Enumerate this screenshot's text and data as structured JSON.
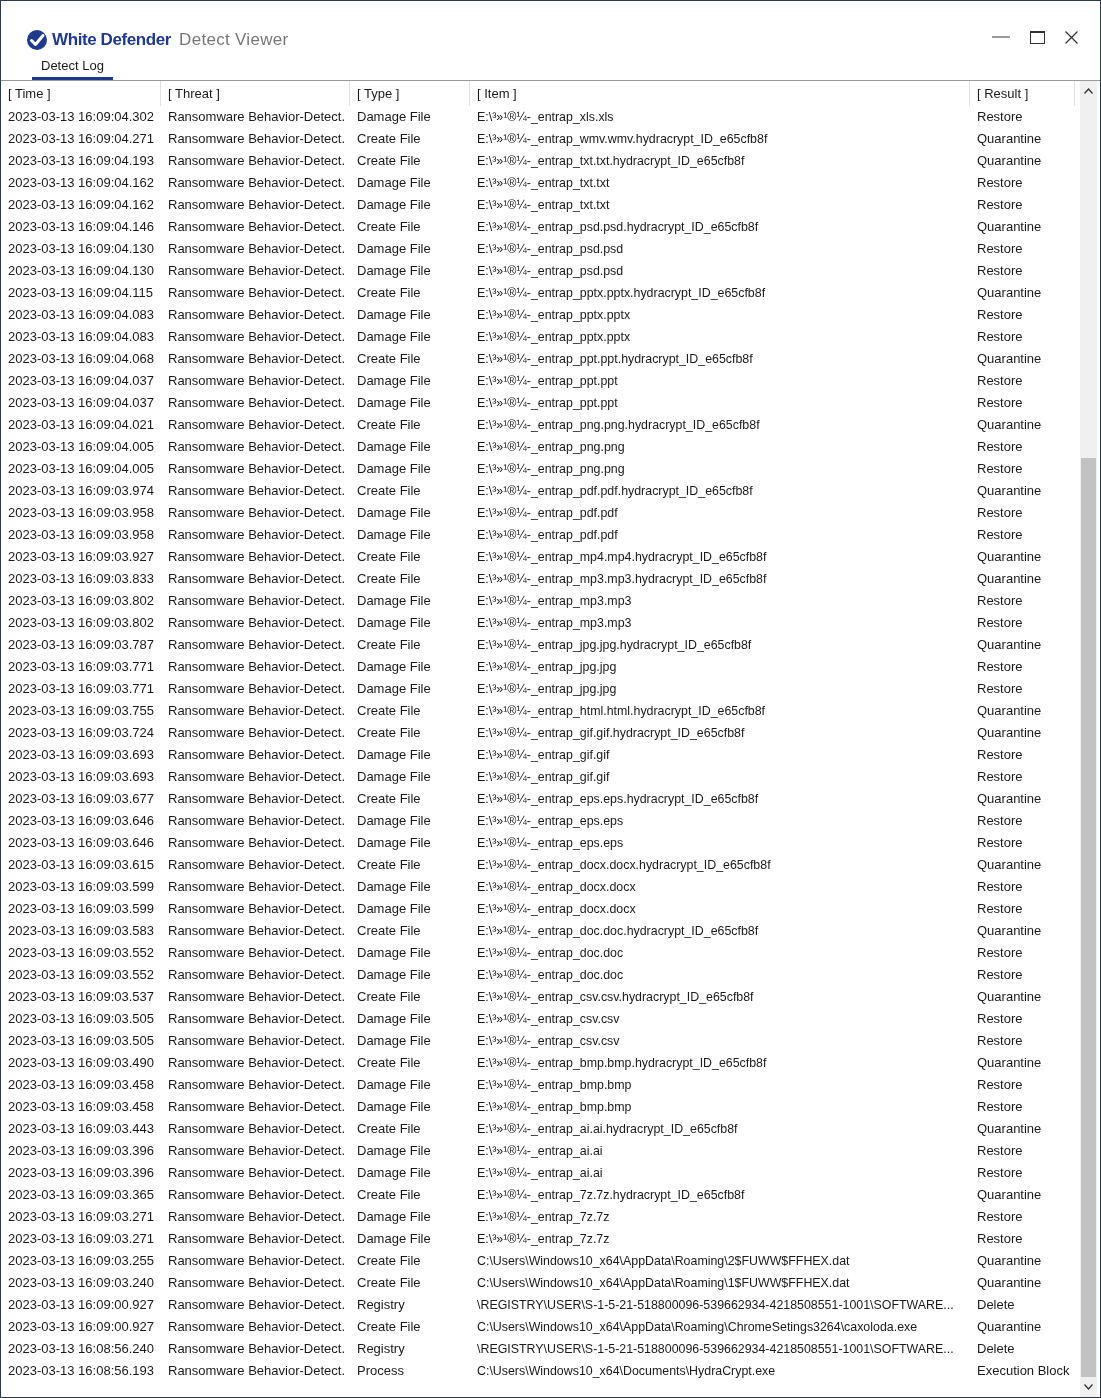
{
  "window": {
    "brand": "White Defender",
    "title": "Detect Viewer"
  },
  "tabs": [
    {
      "label": "Detect Log",
      "selected": true
    }
  ],
  "table": {
    "columns": [
      "[ Time ]",
      "[ Threat ]",
      "[ Type ]",
      "[ Item ]",
      "[ Result ]"
    ],
    "rows": [
      {
        "time": "2023-03-13 16:09:04.302",
        "threat": "Ransomware Behavior-Detect.",
        "type": "Damage File",
        "item": "E:\\³»¹®¼-_entrap_xls.xls",
        "result": "Restore"
      },
      {
        "time": "2023-03-13 16:09:04.271",
        "threat": "Ransomware Behavior-Detect.",
        "type": "Create File",
        "item": "E:\\³»¹®¼-_entrap_wmv.wmv.hydracrypt_ID_e65cfb8f",
        "result": "Quarantine"
      },
      {
        "time": "2023-03-13 16:09:04.193",
        "threat": "Ransomware Behavior-Detect.",
        "type": "Create File",
        "item": "E:\\³»¹®¼-_entrap_txt.txt.hydracrypt_ID_e65cfb8f",
        "result": "Quarantine"
      },
      {
        "time": "2023-03-13 16:09:04.162",
        "threat": "Ransomware Behavior-Detect.",
        "type": "Damage File",
        "item": "E:\\³»¹®¼-_entrap_txt.txt",
        "result": "Restore"
      },
      {
        "time": "2023-03-13 16:09:04.162",
        "threat": "Ransomware Behavior-Detect.",
        "type": "Damage File",
        "item": "E:\\³»¹®¼-_entrap_txt.txt",
        "result": "Restore"
      },
      {
        "time": "2023-03-13 16:09:04.146",
        "threat": "Ransomware Behavior-Detect.",
        "type": "Create File",
        "item": "E:\\³»¹®¼-_entrap_psd.psd.hydracrypt_ID_e65cfb8f",
        "result": "Quarantine"
      },
      {
        "time": "2023-03-13 16:09:04.130",
        "threat": "Ransomware Behavior-Detect.",
        "type": "Damage File",
        "item": "E:\\³»¹®¼-_entrap_psd.psd",
        "result": "Restore"
      },
      {
        "time": "2023-03-13 16:09:04.130",
        "threat": "Ransomware Behavior-Detect.",
        "type": "Damage File",
        "item": "E:\\³»¹®¼-_entrap_psd.psd",
        "result": "Restore"
      },
      {
        "time": "2023-03-13 16:09:04.115",
        "threat": "Ransomware Behavior-Detect.",
        "type": "Create File",
        "item": "E:\\³»¹®¼-_entrap_pptx.pptx.hydracrypt_ID_e65cfb8f",
        "result": "Quarantine"
      },
      {
        "time": "2023-03-13 16:09:04.083",
        "threat": "Ransomware Behavior-Detect.",
        "type": "Damage File",
        "item": "E:\\³»¹®¼-_entrap_pptx.pptx",
        "result": "Restore"
      },
      {
        "time": "2023-03-13 16:09:04.083",
        "threat": "Ransomware Behavior-Detect.",
        "type": "Damage File",
        "item": "E:\\³»¹®¼-_entrap_pptx.pptx",
        "result": "Restore"
      },
      {
        "time": "2023-03-13 16:09:04.068",
        "threat": "Ransomware Behavior-Detect.",
        "type": "Create File",
        "item": "E:\\³»¹®¼-_entrap_ppt.ppt.hydracrypt_ID_e65cfb8f",
        "result": "Quarantine"
      },
      {
        "time": "2023-03-13 16:09:04.037",
        "threat": "Ransomware Behavior-Detect.",
        "type": "Damage File",
        "item": "E:\\³»¹®¼-_entrap_ppt.ppt",
        "result": "Restore"
      },
      {
        "time": "2023-03-13 16:09:04.037",
        "threat": "Ransomware Behavior-Detect.",
        "type": "Damage File",
        "item": "E:\\³»¹®¼-_entrap_ppt.ppt",
        "result": "Restore"
      },
      {
        "time": "2023-03-13 16:09:04.021",
        "threat": "Ransomware Behavior-Detect.",
        "type": "Create File",
        "item": "E:\\³»¹®¼-_entrap_png.png.hydracrypt_ID_e65cfb8f",
        "result": "Quarantine"
      },
      {
        "time": "2023-03-13 16:09:04.005",
        "threat": "Ransomware Behavior-Detect.",
        "type": "Damage File",
        "item": "E:\\³»¹®¼-_entrap_png.png",
        "result": "Restore"
      },
      {
        "time": "2023-03-13 16:09:04.005",
        "threat": "Ransomware Behavior-Detect.",
        "type": "Damage File",
        "item": "E:\\³»¹®¼-_entrap_png.png",
        "result": "Restore"
      },
      {
        "time": "2023-03-13 16:09:03.974",
        "threat": "Ransomware Behavior-Detect.",
        "type": "Create File",
        "item": "E:\\³»¹®¼-_entrap_pdf.pdf.hydracrypt_ID_e65cfb8f",
        "result": "Quarantine"
      },
      {
        "time": "2023-03-13 16:09:03.958",
        "threat": "Ransomware Behavior-Detect.",
        "type": "Damage File",
        "item": "E:\\³»¹®¼-_entrap_pdf.pdf",
        "result": "Restore"
      },
      {
        "time": "2023-03-13 16:09:03.958",
        "threat": "Ransomware Behavior-Detect.",
        "type": "Damage File",
        "item": "E:\\³»¹®¼-_entrap_pdf.pdf",
        "result": "Restore"
      },
      {
        "time": "2023-03-13 16:09:03.927",
        "threat": "Ransomware Behavior-Detect.",
        "type": "Create File",
        "item": "E:\\³»¹®¼-_entrap_mp4.mp4.hydracrypt_ID_e65cfb8f",
        "result": "Quarantine"
      },
      {
        "time": "2023-03-13 16:09:03.833",
        "threat": "Ransomware Behavior-Detect.",
        "type": "Create File",
        "item": "E:\\³»¹®¼-_entrap_mp3.mp3.hydracrypt_ID_e65cfb8f",
        "result": "Quarantine"
      },
      {
        "time": "2023-03-13 16:09:03.802",
        "threat": "Ransomware Behavior-Detect.",
        "type": "Damage File",
        "item": "E:\\³»¹®¼-_entrap_mp3.mp3",
        "result": "Restore"
      },
      {
        "time": "2023-03-13 16:09:03.802",
        "threat": "Ransomware Behavior-Detect.",
        "type": "Damage File",
        "item": "E:\\³»¹®¼-_entrap_mp3.mp3",
        "result": "Restore"
      },
      {
        "time": "2023-03-13 16:09:03.787",
        "threat": "Ransomware Behavior-Detect.",
        "type": "Create File",
        "item": "E:\\³»¹®¼-_entrap_jpg.jpg.hydracrypt_ID_e65cfb8f",
        "result": "Quarantine"
      },
      {
        "time": "2023-03-13 16:09:03.771",
        "threat": "Ransomware Behavior-Detect.",
        "type": "Damage File",
        "item": "E:\\³»¹®¼-_entrap_jpg.jpg",
        "result": "Restore"
      },
      {
        "time": "2023-03-13 16:09:03.771",
        "threat": "Ransomware Behavior-Detect.",
        "type": "Damage File",
        "item": "E:\\³»¹®¼-_entrap_jpg.jpg",
        "result": "Restore"
      },
      {
        "time": "2023-03-13 16:09:03.755",
        "threat": "Ransomware Behavior-Detect.",
        "type": "Create File",
        "item": "E:\\³»¹®¼-_entrap_html.html.hydracrypt_ID_e65cfb8f",
        "result": "Quarantine"
      },
      {
        "time": "2023-03-13 16:09:03.724",
        "threat": "Ransomware Behavior-Detect.",
        "type": "Create File",
        "item": "E:\\³»¹®¼-_entrap_gif.gif.hydracrypt_ID_e65cfb8f",
        "result": "Quarantine"
      },
      {
        "time": "2023-03-13 16:09:03.693",
        "threat": "Ransomware Behavior-Detect.",
        "type": "Damage File",
        "item": "E:\\³»¹®¼-_entrap_gif.gif",
        "result": "Restore"
      },
      {
        "time": "2023-03-13 16:09:03.693",
        "threat": "Ransomware Behavior-Detect.",
        "type": "Damage File",
        "item": "E:\\³»¹®¼-_entrap_gif.gif",
        "result": "Restore"
      },
      {
        "time": "2023-03-13 16:09:03.677",
        "threat": "Ransomware Behavior-Detect.",
        "type": "Create File",
        "item": "E:\\³»¹®¼-_entrap_eps.eps.hydracrypt_ID_e65cfb8f",
        "result": "Quarantine"
      },
      {
        "time": "2023-03-13 16:09:03.646",
        "threat": "Ransomware Behavior-Detect.",
        "type": "Damage File",
        "item": "E:\\³»¹®¼-_entrap_eps.eps",
        "result": "Restore"
      },
      {
        "time": "2023-03-13 16:09:03.646",
        "threat": "Ransomware Behavior-Detect.",
        "type": "Damage File",
        "item": "E:\\³»¹®¼-_entrap_eps.eps",
        "result": "Restore"
      },
      {
        "time": "2023-03-13 16:09:03.615",
        "threat": "Ransomware Behavior-Detect.",
        "type": "Create File",
        "item": "E:\\³»¹®¼-_entrap_docx.docx.hydracrypt_ID_e65cfb8f",
        "result": "Quarantine"
      },
      {
        "time": "2023-03-13 16:09:03.599",
        "threat": "Ransomware Behavior-Detect.",
        "type": "Damage File",
        "item": "E:\\³»¹®¼-_entrap_docx.docx",
        "result": "Restore"
      },
      {
        "time": "2023-03-13 16:09:03.599",
        "threat": "Ransomware Behavior-Detect.",
        "type": "Damage File",
        "item": "E:\\³»¹®¼-_entrap_docx.docx",
        "result": "Restore"
      },
      {
        "time": "2023-03-13 16:09:03.583",
        "threat": "Ransomware Behavior-Detect.",
        "type": "Create File",
        "item": "E:\\³»¹®¼-_entrap_doc.doc.hydracrypt_ID_e65cfb8f",
        "result": "Quarantine"
      },
      {
        "time": "2023-03-13 16:09:03.552",
        "threat": "Ransomware Behavior-Detect.",
        "type": "Damage File",
        "item": "E:\\³»¹®¼-_entrap_doc.doc",
        "result": "Restore"
      },
      {
        "time": "2023-03-13 16:09:03.552",
        "threat": "Ransomware Behavior-Detect.",
        "type": "Damage File",
        "item": "E:\\³»¹®¼-_entrap_doc.doc",
        "result": "Restore"
      },
      {
        "time": "2023-03-13 16:09:03.537",
        "threat": "Ransomware Behavior-Detect.",
        "type": "Create File",
        "item": "E:\\³»¹®¼-_entrap_csv.csv.hydracrypt_ID_e65cfb8f",
        "result": "Quarantine"
      },
      {
        "time": "2023-03-13 16:09:03.505",
        "threat": "Ransomware Behavior-Detect.",
        "type": "Damage File",
        "item": "E:\\³»¹®¼-_entrap_csv.csv",
        "result": "Restore"
      },
      {
        "time": "2023-03-13 16:09:03.505",
        "threat": "Ransomware Behavior-Detect.",
        "type": "Damage File",
        "item": "E:\\³»¹®¼-_entrap_csv.csv",
        "result": "Restore"
      },
      {
        "time": "2023-03-13 16:09:03.490",
        "threat": "Ransomware Behavior-Detect.",
        "type": "Create File",
        "item": "E:\\³»¹®¼-_entrap_bmp.bmp.hydracrypt_ID_e65cfb8f",
        "result": "Quarantine"
      },
      {
        "time": "2023-03-13 16:09:03.458",
        "threat": "Ransomware Behavior-Detect.",
        "type": "Damage File",
        "item": "E:\\³»¹®¼-_entrap_bmp.bmp",
        "result": "Restore"
      },
      {
        "time": "2023-03-13 16:09:03.458",
        "threat": "Ransomware Behavior-Detect.",
        "type": "Damage File",
        "item": "E:\\³»¹®¼-_entrap_bmp.bmp",
        "result": "Restore"
      },
      {
        "time": "2023-03-13 16:09:03.443",
        "threat": "Ransomware Behavior-Detect.",
        "type": "Create File",
        "item": "E:\\³»¹®¼-_entrap_ai.ai.hydracrypt_ID_e65cfb8f",
        "result": "Quarantine"
      },
      {
        "time": "2023-03-13 16:09:03.396",
        "threat": "Ransomware Behavior-Detect.",
        "type": "Damage File",
        "item": "E:\\³»¹®¼-_entrap_ai.ai",
        "result": "Restore"
      },
      {
        "time": "2023-03-13 16:09:03.396",
        "threat": "Ransomware Behavior-Detect.",
        "type": "Damage File",
        "item": "E:\\³»¹®¼-_entrap_ai.ai",
        "result": "Restore"
      },
      {
        "time": "2023-03-13 16:09:03.365",
        "threat": "Ransomware Behavior-Detect.",
        "type": "Create File",
        "item": "E:\\³»¹®¼-_entrap_7z.7z.hydracrypt_ID_e65cfb8f",
        "result": "Quarantine"
      },
      {
        "time": "2023-03-13 16:09:03.271",
        "threat": "Ransomware Behavior-Detect.",
        "type": "Damage File",
        "item": "E:\\³»¹®¼-_entrap_7z.7z",
        "result": "Restore"
      },
      {
        "time": "2023-03-13 16:09:03.271",
        "threat": "Ransomware Behavior-Detect.",
        "type": "Damage File",
        "item": "E:\\³»¹®¼-_entrap_7z.7z",
        "result": "Restore"
      },
      {
        "time": "2023-03-13 16:09:03.255",
        "threat": "Ransomware Behavior-Detect.",
        "type": "Create File",
        "item": "C:\\Users\\Windows10_x64\\AppData\\Roaming\\2$FUWW$FFHEX.dat",
        "result": "Quarantine"
      },
      {
        "time": "2023-03-13 16:09:03.240",
        "threat": "Ransomware Behavior-Detect.",
        "type": "Create File",
        "item": "C:\\Users\\Windows10_x64\\AppData\\Roaming\\1$FUWW$FFHEX.dat",
        "result": "Quarantine"
      },
      {
        "time": "2023-03-13 16:09:00.927",
        "threat": "Ransomware Behavior-Detect.",
        "type": "Registry",
        "item": "\\REGISTRY\\USER\\S-1-5-21-518800096-539662934-4218508551-1001\\SOFTWARE...",
        "result": "Delete"
      },
      {
        "time": "2023-03-13 16:09:00.927",
        "threat": "Ransomware Behavior-Detect.",
        "type": "Create File",
        "item": "C:\\Users\\Windows10_x64\\AppData\\Roaming\\ChromeSetings3264\\caxoloda.exe",
        "result": "Quarantine"
      },
      {
        "time": "2023-03-13 16:08:56.240",
        "threat": "Ransomware Behavior-Detect.",
        "type": "Registry",
        "item": "\\REGISTRY\\USER\\S-1-5-21-518800096-539662934-4218508551-1001\\SOFTWARE...",
        "result": "Delete"
      },
      {
        "time": "2023-03-13 16:08:56.193",
        "threat": "Ransomware Behavior-Detect.",
        "type": "Process",
        "item": "C:\\Users\\Windows10_x64\\Documents\\HydraCrypt.exe",
        "result": "Execution Block"
      }
    ]
  }
}
